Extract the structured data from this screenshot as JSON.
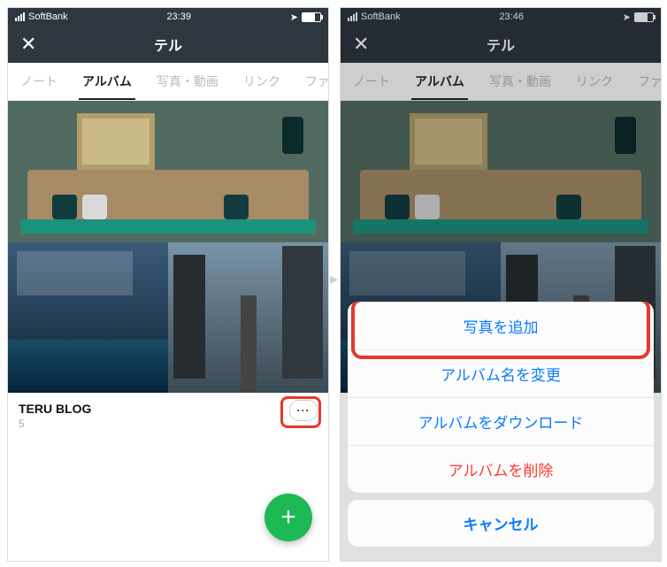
{
  "left": {
    "status": {
      "carrier": "SoftBank",
      "time": "23:39"
    },
    "header": {
      "title": "テル"
    },
    "tabs": [
      "ノート",
      "アルバム",
      "写真・動画",
      "リンク",
      "ファ"
    ],
    "active_tab": 1,
    "album": {
      "title": "TERU BLOG",
      "count": "5"
    },
    "fab_label": "+"
  },
  "right": {
    "status": {
      "carrier": "SoftBank",
      "time": "23:46"
    },
    "header": {
      "title": "テル"
    },
    "tabs": [
      "ノート",
      "アルバム",
      "写真・動画",
      "リンク",
      "ファ"
    ],
    "active_tab": 1,
    "sheet": {
      "items": [
        {
          "label": "写真を追加",
          "danger": false
        },
        {
          "label": "アルバム名を変更",
          "danger": false
        },
        {
          "label": "アルバムをダウンロード",
          "danger": false
        },
        {
          "label": "アルバムを削除",
          "danger": true
        }
      ],
      "cancel": "キャンセル",
      "highlighted_index": 0
    }
  }
}
